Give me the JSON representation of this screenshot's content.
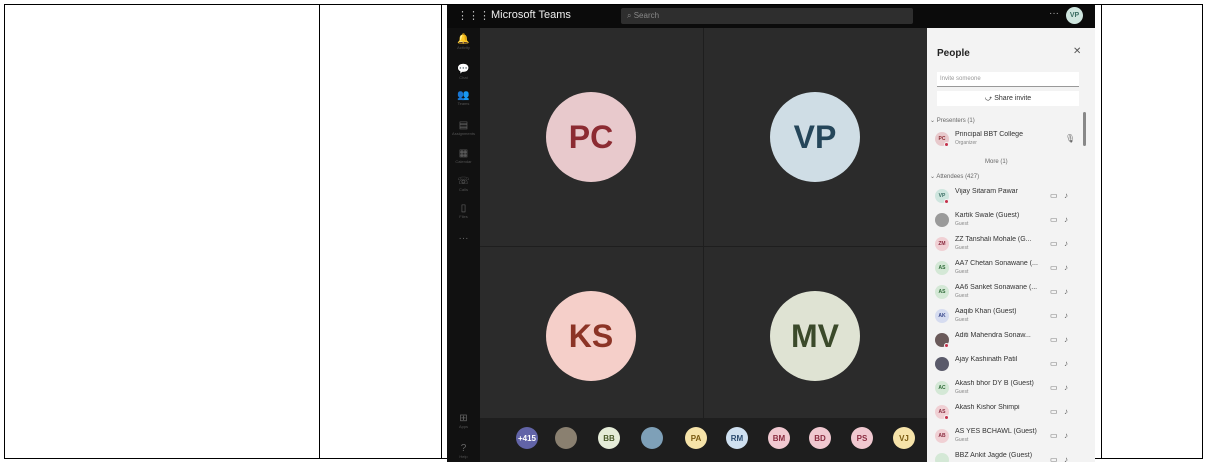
{
  "app": {
    "title": "Microsoft Teams",
    "search_placeholder": "Search",
    "more": "···",
    "user_initials": "VP"
  },
  "rail": [
    {
      "icon": "bell-icon",
      "glyph": "🔔",
      "label": "Activity"
    },
    {
      "icon": "chat-icon",
      "glyph": "💬",
      "label": "Chat"
    },
    {
      "icon": "teams-icon",
      "glyph": "👥",
      "label": "Teams"
    },
    {
      "icon": "assignments-icon",
      "glyph": "▤",
      "label": "Assignments"
    },
    {
      "icon": "calendar-icon",
      "glyph": "▦",
      "label": "Calendar"
    },
    {
      "icon": "phone-icon",
      "glyph": "☏",
      "label": "Calls"
    },
    {
      "icon": "files-icon",
      "glyph": "▯",
      "label": "Files"
    },
    {
      "icon": "more-icon",
      "glyph": "···",
      "label": ""
    },
    {
      "icon": "apps-icon",
      "glyph": "⊞",
      "label": "Apps"
    },
    {
      "icon": "help-icon",
      "glyph": "?",
      "label": "Help"
    }
  ],
  "tiles": [
    {
      "initials": "PC",
      "bg": "#e8c9cc",
      "fg": "#8c2b32"
    },
    {
      "initials": "VP",
      "bg": "#cfdde5",
      "fg": "#25465a"
    },
    {
      "initials": "KS",
      "bg": "#f5cfc9",
      "fg": "#8c3426"
    },
    {
      "initials": "MV",
      "bg": "#dfe3d3",
      "fg": "#3b4a2a"
    }
  ],
  "strip": [
    {
      "label": "+415",
      "bg": "#6264a7",
      "fg": "#ffffff",
      "kind": "count"
    },
    {
      "label": "",
      "bg": "#8a8070",
      "fg": "#ffffff",
      "kind": "photo"
    },
    {
      "label": "BB",
      "bg": "#e5ecd8",
      "fg": "#4a5a2a",
      "kind": "initials"
    },
    {
      "label": "",
      "bg": "#7ea0b8",
      "fg": "#ffffff",
      "kind": "photo"
    },
    {
      "label": "PA",
      "bg": "#f6e3a9",
      "fg": "#7a5a10",
      "kind": "initials"
    },
    {
      "label": "RM",
      "bg": "#cfe0f0",
      "fg": "#2c4c70",
      "kind": "initials"
    },
    {
      "label": "BM",
      "bg": "#f0c8d0",
      "fg": "#8a2c40",
      "kind": "initials"
    },
    {
      "label": "BD",
      "bg": "#f0c8d0",
      "fg": "#8a2c40",
      "kind": "initials"
    },
    {
      "label": "PS",
      "bg": "#f0c8d0",
      "fg": "#8a2c40",
      "kind": "initials"
    },
    {
      "label": "VJ",
      "bg": "#f6e3a9",
      "fg": "#7a5a10",
      "kind": "initials"
    }
  ],
  "people": {
    "title": "People",
    "invite_placeholder": "Invite someone",
    "share_invite": "Share invite",
    "presenters_label": "Presenters (1)",
    "presenter": {
      "initials": "PC",
      "name": "Principal BBT College",
      "role": "Organizer"
    },
    "more_label": "More (1)",
    "attendees_label": "Attendees (427)",
    "attendees": [
      {
        "initials": "VP",
        "name": "Vijay Sitaram Pawar",
        "sub": "",
        "bg": "#cfe6df",
        "fg": "#3a6d62",
        "status": true
      },
      {
        "initials": "",
        "name": "Kartik Swale (Guest)",
        "sub": "Guest",
        "bg": "#9a9a9a",
        "fg": "#ffffff",
        "status": false
      },
      {
        "initials": "ZM",
        "name": "ZZ Tanshali Mohale (G...",
        "sub": "Guest",
        "bg": "#f0d0d4",
        "fg": "#8a2c40",
        "status": false
      },
      {
        "initials": "AS",
        "name": "AA7 Chetan Sonawane (...",
        "sub": "Guest",
        "bg": "#d4e8d6",
        "fg": "#2f6a38",
        "status": false
      },
      {
        "initials": "AS",
        "name": "AA6 Sanket Sonawane (...",
        "sub": "Guest",
        "bg": "#d4e8d6",
        "fg": "#2f6a38",
        "status": false
      },
      {
        "initials": "AK",
        "name": "Aaqib Khan (Guest)",
        "sub": "Guest",
        "bg": "#d6dcf0",
        "fg": "#36458a",
        "status": false
      },
      {
        "initials": "",
        "name": "Aditi Mahendra Sonaw...",
        "sub": "",
        "bg": "#6a5a5a",
        "fg": "#ffffff",
        "status": true
      },
      {
        "initials": "",
        "name": "Ajay Kashinath Patil",
        "sub": "",
        "bg": "#5a5a6a",
        "fg": "#ffffff",
        "status": false
      },
      {
        "initials": "AC",
        "name": "Akash bhor DY B (Guest)",
        "sub": "Guest",
        "bg": "#d4e8d6",
        "fg": "#2f6a38",
        "status": false
      },
      {
        "initials": "AS",
        "name": "Akash Kishor Shimpi",
        "sub": "",
        "bg": "#f0d0d4",
        "fg": "#8a2c40",
        "status": true
      },
      {
        "initials": "AB",
        "name": "AS YES BCHAWL (Guest)",
        "sub": "Guest",
        "bg": "#f0d0d4",
        "fg": "#8a2c40",
        "status": false
      },
      {
        "initials": "",
        "name": "BBZ Ankit Jagde (Guest)",
        "sub": "",
        "bg": "#d4e8d6",
        "fg": "#2f6a38",
        "status": false
      }
    ]
  }
}
